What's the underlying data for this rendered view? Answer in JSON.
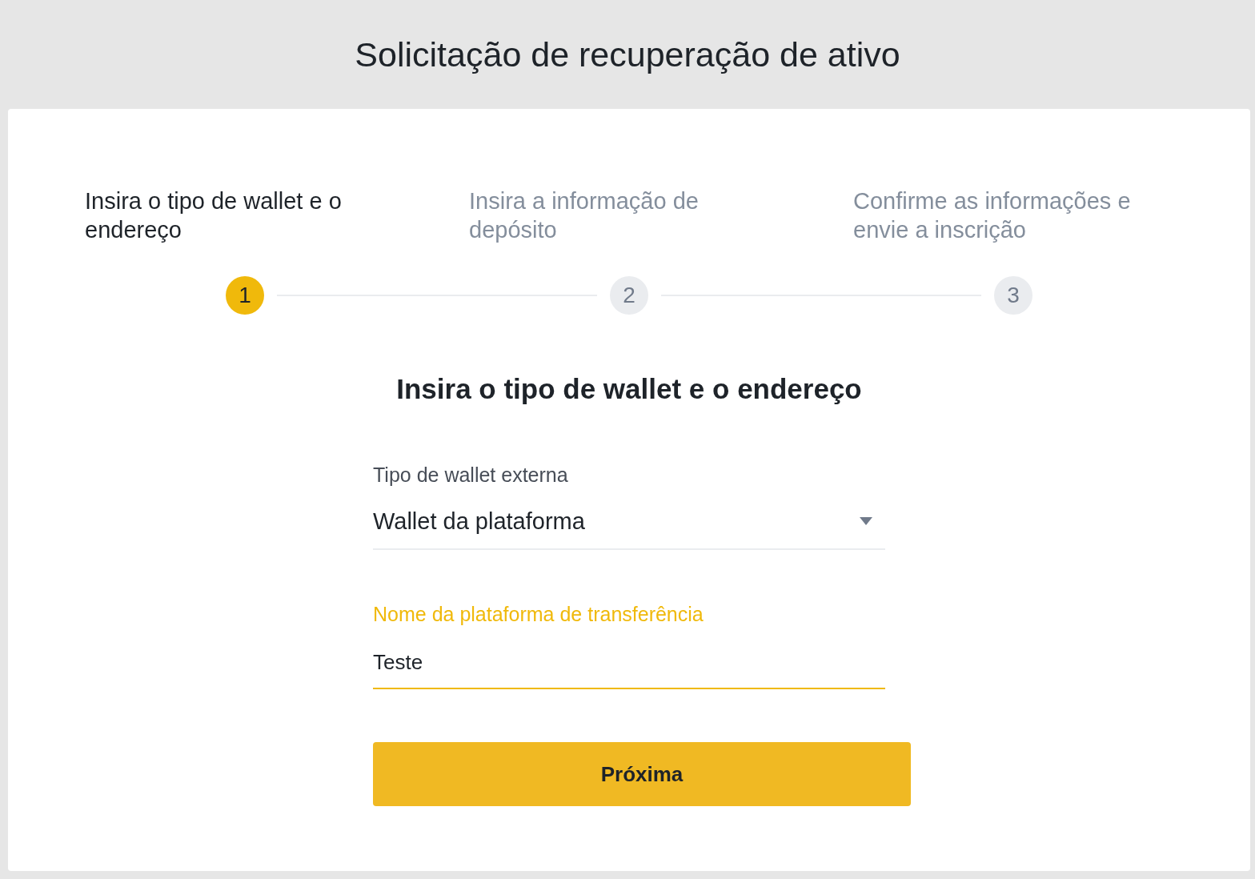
{
  "page": {
    "title": "Solicitação de recuperação de ativo"
  },
  "steps": [
    {
      "label": "Insira o tipo de wallet e o endereço",
      "number": "1",
      "selected": true
    },
    {
      "label": "Insira a informação de depósito",
      "number": "2",
      "selected": false
    },
    {
      "label": "Confirme as informações e envie a inscrição",
      "number": "3",
      "selected": false
    }
  ],
  "form": {
    "heading": "Insira o tipo de wallet e o endereço",
    "fields": [
      {
        "kind": "select",
        "label": "Tipo de wallet externa",
        "value": "Wallet da plataforma",
        "focused": false
      },
      {
        "kind": "text",
        "label": "Nome da plataforma de transferência",
        "value": "Teste",
        "focused": true
      }
    ],
    "submit": "Próxima"
  }
}
